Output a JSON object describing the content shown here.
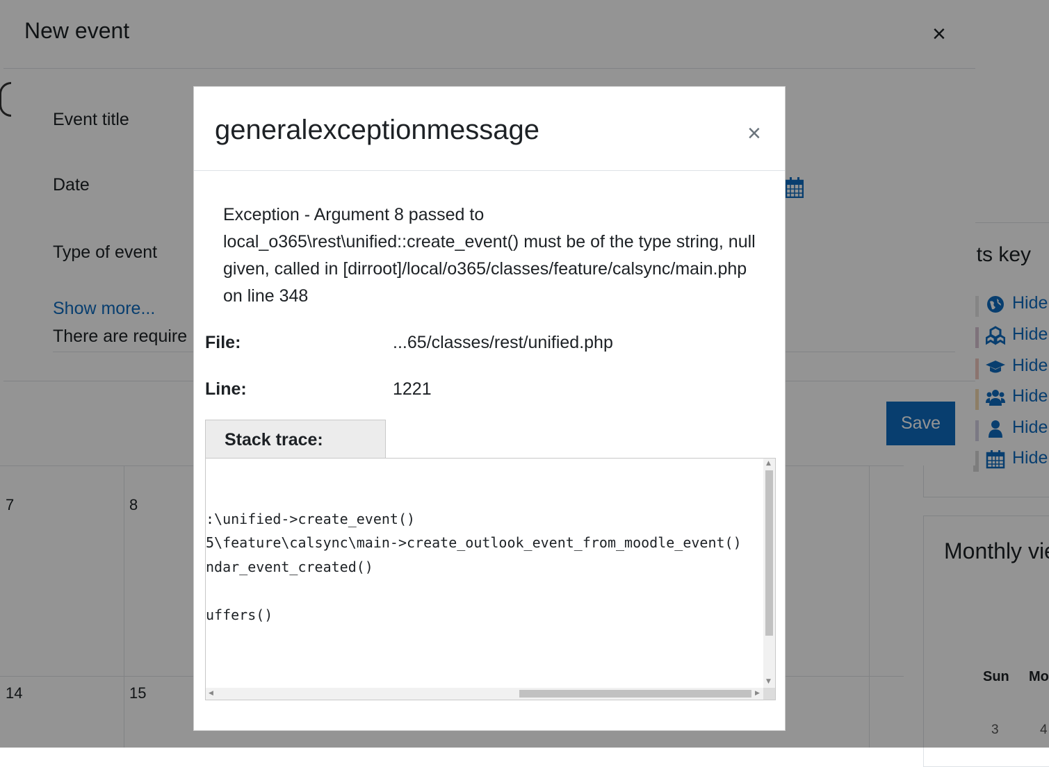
{
  "background": {
    "calendar_days": [
      "7",
      "8",
      "14",
      "15"
    ],
    "events_key_title": "nts key",
    "events_key_items": [
      {
        "label": "Hide",
        "icon": "globe-icon",
        "color": "#e6e6e6"
      },
      {
        "label": "Hide",
        "icon": "cubes-icon",
        "color": "#d9c4d4"
      },
      {
        "label": "Hide",
        "icon": "graduation-cap-icon",
        "color": "#f0c8c0"
      },
      {
        "label": "Hide",
        "icon": "users-icon",
        "color": "#f3d9b0"
      },
      {
        "label": "Hide",
        "icon": "user-icon",
        "color": "#d4d0e4"
      },
      {
        "label": "Hide",
        "icon": "calendar-icon",
        "color": "#d8d8d8"
      }
    ],
    "monthly_view_title": "Monthly vie",
    "mini_calendar": {
      "headers": [
        "Sun",
        "Mo"
      ],
      "days": [
        "3",
        "4"
      ]
    }
  },
  "new_event_modal": {
    "title": "New event",
    "close_label": "×",
    "fields": [
      "Event title",
      "Date",
      "Type of event"
    ],
    "show_more_link": "Show more...",
    "required_notice": "There are require",
    "save_label": "Save"
  },
  "error_modal": {
    "title": "generalexceptionmessage",
    "close_label": "×",
    "message": "Exception - Argument 8 passed to local_o365\\rest\\unified::create_event() must be of the type string, null given, called in [dirroot]/local/o365/classes/feature/calsync/main.php on line 348",
    "file_label": "File:",
    "file_value": "...65/classes/rest/unified.php",
    "line_label": "Line:",
    "line_value": "1221",
    "stack_trace_label": "Stack trace:",
    "stack_trace_lines": [
      ":\\unified->create_event()",
      "5\\feature\\calsync\\main->create_outlook_event_from_moodle_event()",
      "ndar_event_created()",
      "",
      "uffers()"
    ]
  }
}
